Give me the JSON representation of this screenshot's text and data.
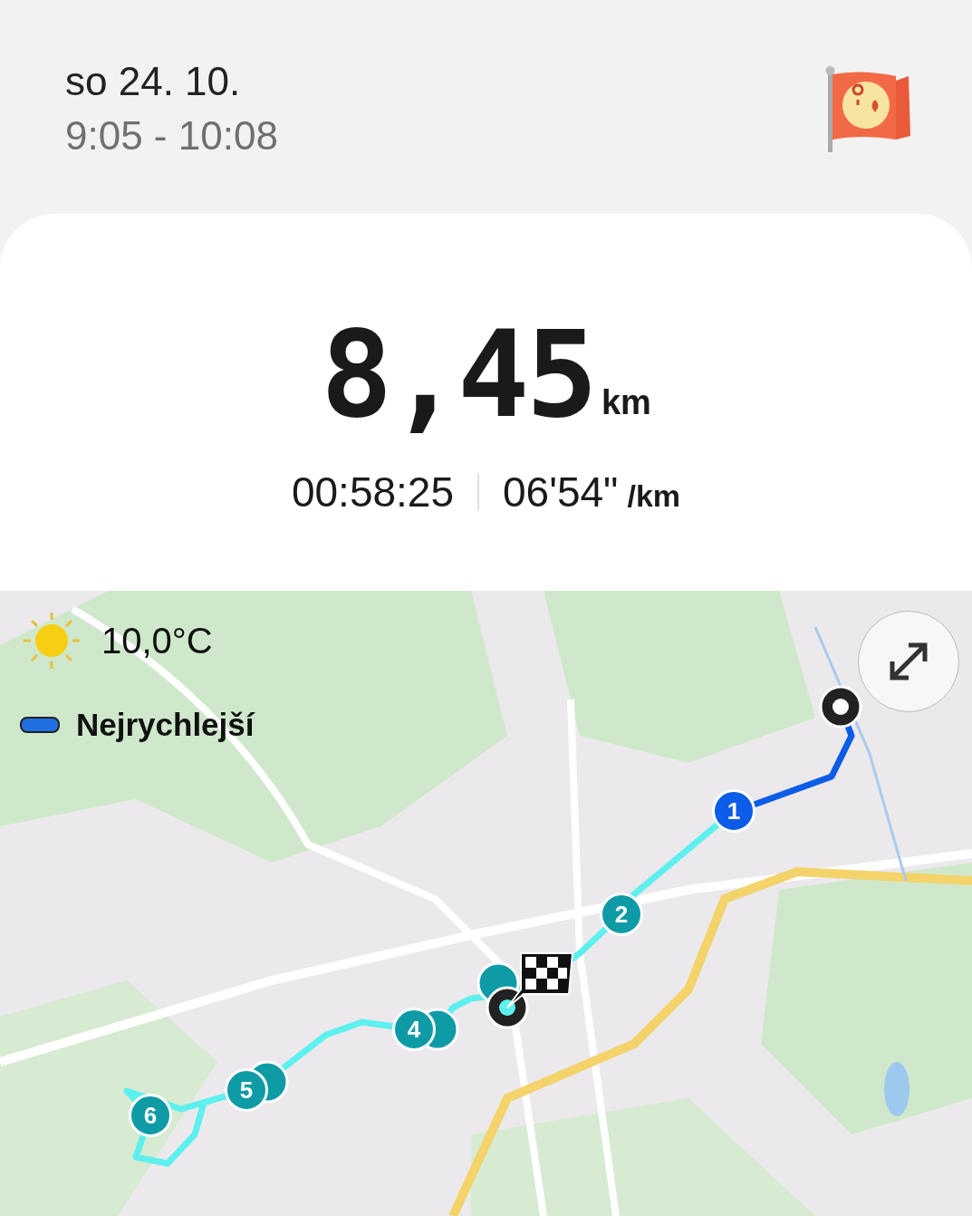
{
  "header": {
    "date": "so 24. 10.",
    "time_range": "9:05 - 10:08"
  },
  "summary": {
    "distance": "8,45",
    "distance_unit": "km",
    "duration": "00:58:25",
    "pace": "06'54\"",
    "pace_unit": "/km"
  },
  "map": {
    "weather": "10,0°C",
    "legend": [
      {
        "label": "Nejrychlejší",
        "color": "#1f6fe0"
      }
    ],
    "markers": [
      {
        "label": "1",
        "color": "#0b5ce6"
      },
      {
        "label": "2",
        "color": "#0f9ba6"
      },
      {
        "label": "4",
        "color": "#0f9ba6"
      },
      {
        "label": "5",
        "color": "#0f9ba6"
      },
      {
        "label": "6",
        "color": "#0f9ba6"
      }
    ]
  }
}
